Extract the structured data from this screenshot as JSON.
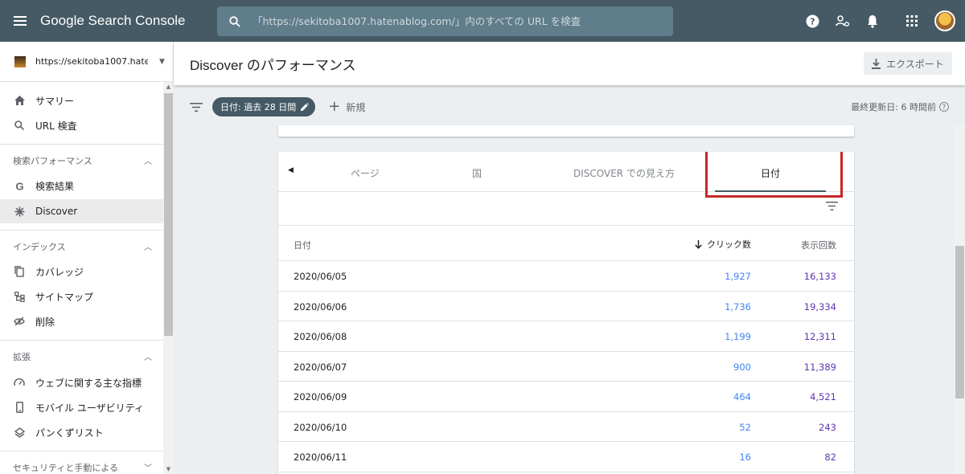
{
  "app": {
    "title": "Google Search Console"
  },
  "search": {
    "placeholder": "「https://sekitoba1007.hatenablog.com/」内のすべての URL を検査"
  },
  "top_icons": [
    "help-icon",
    "manage-users-icon",
    "notifications-icon",
    "apps-grid-icon",
    "avatar"
  ],
  "sidebar": {
    "property": {
      "name": "https://sekitoba1007.hatena..."
    },
    "items": [
      {
        "label": "サマリー",
        "icon": "home-icon"
      },
      {
        "label": "URL 検査",
        "icon": "search-icon"
      }
    ],
    "sections": [
      {
        "title": "検索パフォーマンス",
        "items": [
          {
            "label": "検索結果",
            "icon": "google-g-icon"
          },
          {
            "label": "Discover",
            "icon": "asterisk-icon",
            "active": true
          }
        ]
      },
      {
        "title": "インデックス",
        "items": [
          {
            "label": "カバレッジ",
            "icon": "copy-icon"
          },
          {
            "label": "サイトマップ",
            "icon": "sitemap-icon"
          },
          {
            "label": "削除",
            "icon": "visibility-off-icon"
          }
        ]
      },
      {
        "title": "拡張",
        "items": [
          {
            "label": "ウェブに関する主な指標",
            "icon": "speed-icon"
          },
          {
            "label": "モバイル ユーザビリティ",
            "icon": "smartphone-icon"
          },
          {
            "label": "パンくずリスト",
            "icon": "layers-icon"
          }
        ]
      },
      {
        "title": "セキュリティと手動による"
      }
    ]
  },
  "main": {
    "title": "Discover のパフォーマンス",
    "export_label": "エクスポート",
    "filter": {
      "chip_label": "日付: 過去 28 日間",
      "new_label": "新規",
      "last_updated": "最終更新日: 6 時間前"
    },
    "tabs": [
      {
        "label": "ページ"
      },
      {
        "label": "国"
      },
      {
        "label": "DISCOVER での見え方"
      },
      {
        "label": "日付",
        "active": true
      }
    ],
    "table": {
      "headers": {
        "date": "日付",
        "clicks": "クリック数",
        "impressions": "表示回数"
      },
      "sort": {
        "column": "clicks",
        "direction": "descending"
      },
      "rows": [
        {
          "date": "2020/06/05",
          "clicks": "1,927",
          "impressions": "16,133"
        },
        {
          "date": "2020/06/06",
          "clicks": "1,736",
          "impressions": "19,334"
        },
        {
          "date": "2020/06/08",
          "clicks": "1,199",
          "impressions": "12,311"
        },
        {
          "date": "2020/06/07",
          "clicks": "900",
          "impressions": "11,389"
        },
        {
          "date": "2020/06/09",
          "clicks": "464",
          "impressions": "4,521"
        },
        {
          "date": "2020/06/10",
          "clicks": "52",
          "impressions": "243"
        },
        {
          "date": "2020/06/11",
          "clicks": "16",
          "impressions": "82"
        }
      ]
    }
  },
  "colors": {
    "topbar": "#455a64",
    "clicks": "#4285f4",
    "impressions": "#5e35b1",
    "highlight": "#c62828"
  }
}
